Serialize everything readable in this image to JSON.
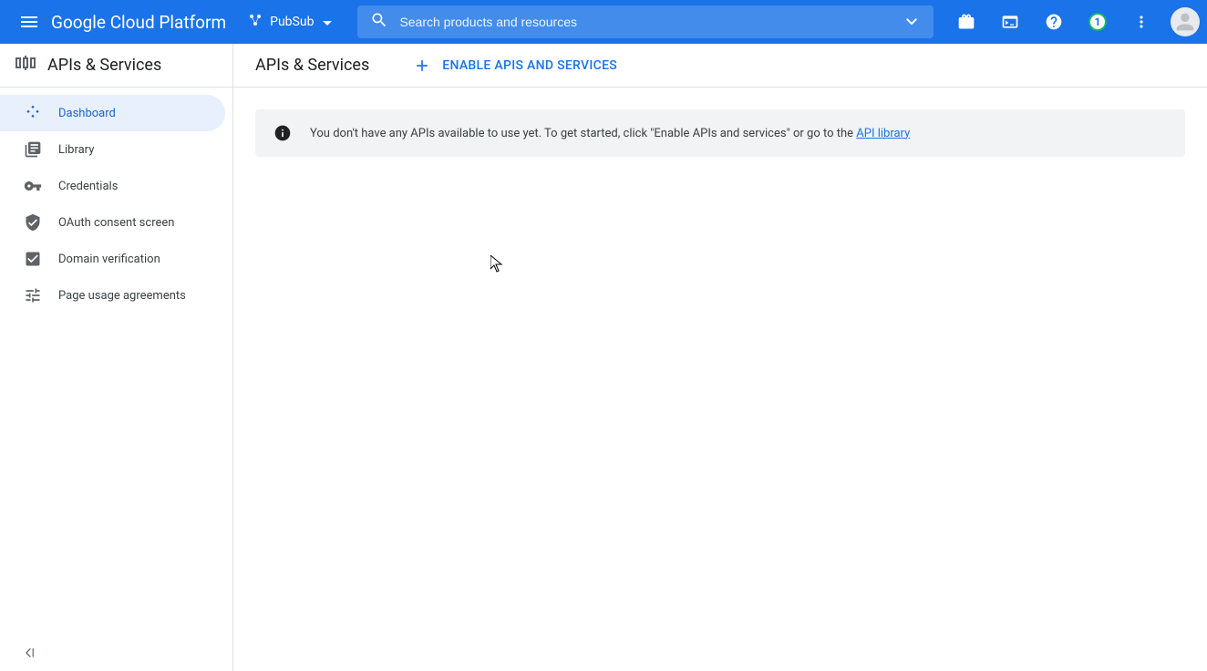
{
  "header": {
    "brand": "Google Cloud Platform",
    "project_name": "PubSub",
    "search_placeholder": "Search products and resources",
    "notification_count": "1"
  },
  "sidebar": {
    "title": "APIs & Services",
    "items": [
      {
        "label": "Dashboard"
      },
      {
        "label": "Library"
      },
      {
        "label": "Credentials"
      },
      {
        "label": "OAuth consent screen"
      },
      {
        "label": "Domain verification"
      },
      {
        "label": "Page usage agreements"
      }
    ]
  },
  "main": {
    "title": "APIs & Services",
    "enable_label": "ENABLE APIS AND SERVICES",
    "banner_text_prefix": "You don't have any APIs available to use yet. To get started, click \"Enable APIs and services\" or go to the ",
    "banner_link_text": "API library"
  }
}
